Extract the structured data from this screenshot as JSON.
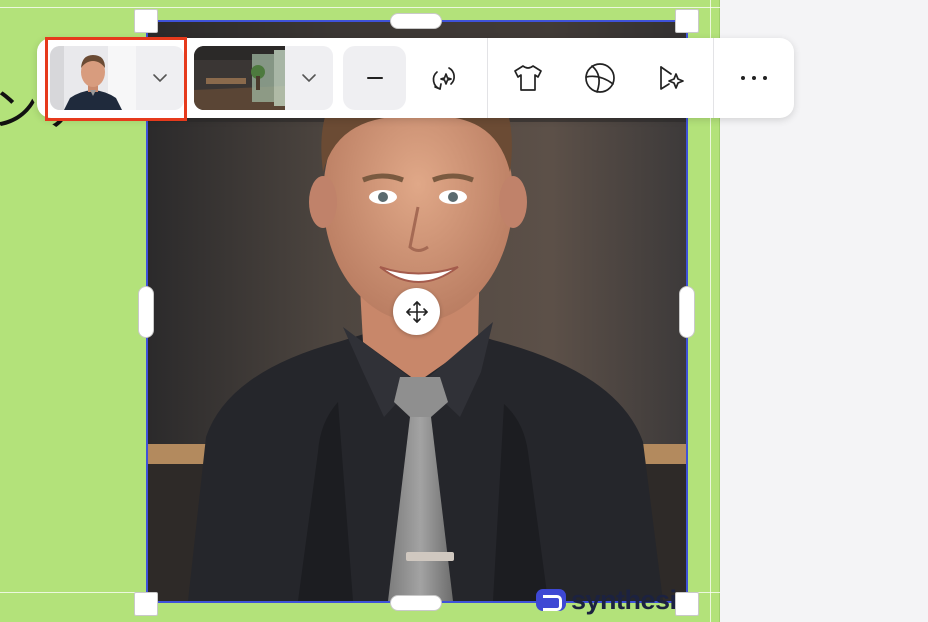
{
  "slide": {
    "background_color": "#b3e27a",
    "visible_text": "ンケ"
  },
  "avatar": {
    "frame_color": "#3f52d9",
    "watermark_text": "synthesi"
  },
  "toolbar": {
    "avatar_thumbnail_icon": "avatar-portrait",
    "background_thumbnail_icon": "office-background",
    "highlight_color": "#e63a1c",
    "tools": [
      {
        "icon": "minus-icon"
      },
      {
        "icon": "gesture-sparkle-icon"
      },
      {
        "icon": "shirt-icon"
      },
      {
        "icon": "sphere-icon"
      },
      {
        "icon": "animate-sparkle-icon"
      },
      {
        "icon": "more-horizontal-icon"
      }
    ]
  }
}
